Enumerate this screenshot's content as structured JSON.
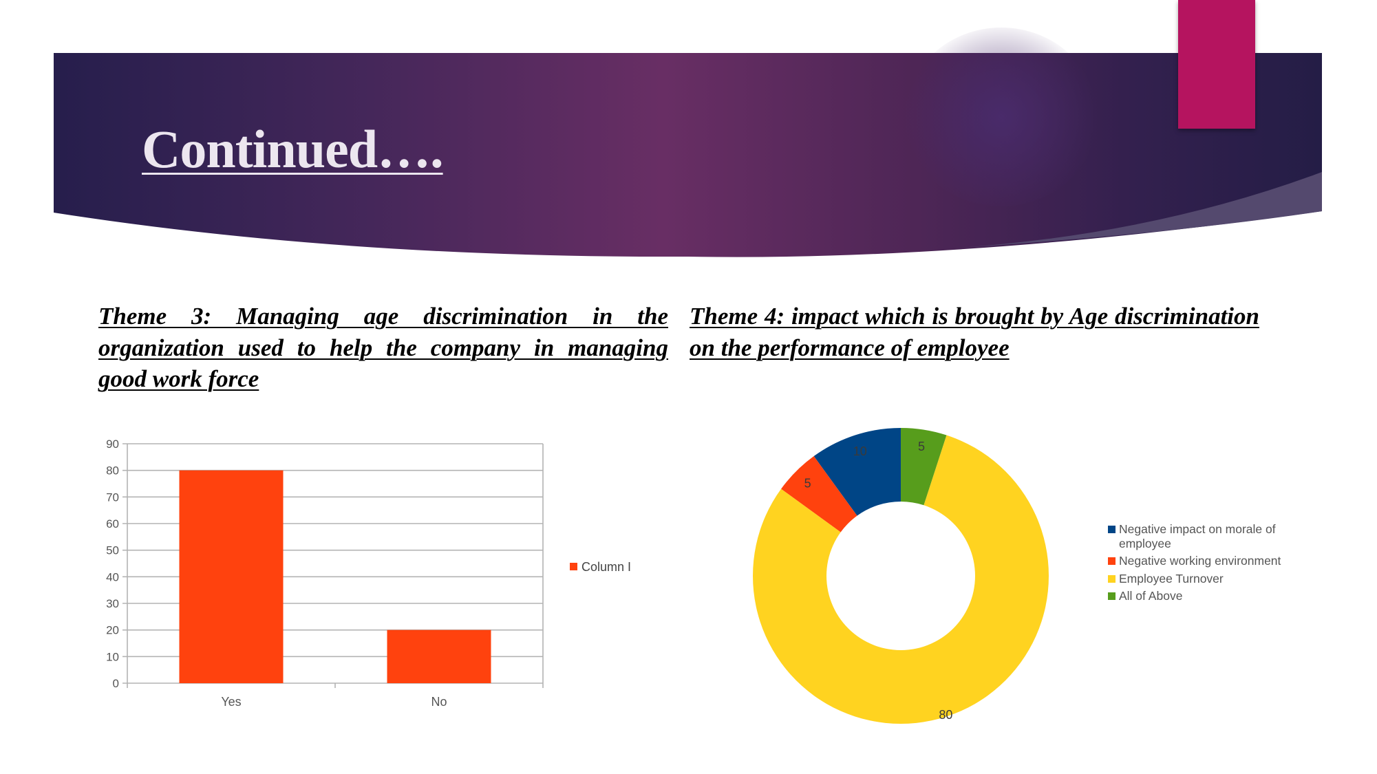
{
  "slide": {
    "title": "Continued….",
    "colors": {
      "banner_dark": "#261e48",
      "banner_mid": "#662d63",
      "accent_pink": "#b5145f",
      "banner_strip": "#54496e"
    }
  },
  "themes": [
    {
      "id": "theme3",
      "text": "Theme 3: Managing age discrimination in the organization used to help the company in managing good work force"
    },
    {
      "id": "theme4",
      "text": "Theme 4: impact which is brought by Age discrimination on the performance of employee"
    }
  ],
  "chart_data": [
    {
      "type": "bar",
      "title": "",
      "xlabel": "",
      "ylabel": "",
      "categories": [
        "Yes",
        "No"
      ],
      "series": [
        {
          "name": "Column I",
          "color": "#ff420e",
          "values": [
            80,
            20
          ]
        }
      ],
      "ylim": [
        0,
        90
      ],
      "yticks": [
        0,
        10,
        20,
        30,
        40,
        50,
        60,
        70,
        80,
        90
      ],
      "grid": true,
      "legend": "right"
    },
    {
      "type": "pie",
      "variant": "donut",
      "title": "",
      "labels": [
        "Negative impact on morale of employee",
        "Negative working environment",
        "Employee Turnover",
        "All of Above"
      ],
      "values": [
        10,
        5,
        80,
        5
      ],
      "colors": [
        "#004586",
        "#ff420e",
        "#ffd320",
        "#579d1c"
      ],
      "data_labels": [
        "10",
        "5",
        "80",
        "5"
      ],
      "legend": "right"
    }
  ]
}
